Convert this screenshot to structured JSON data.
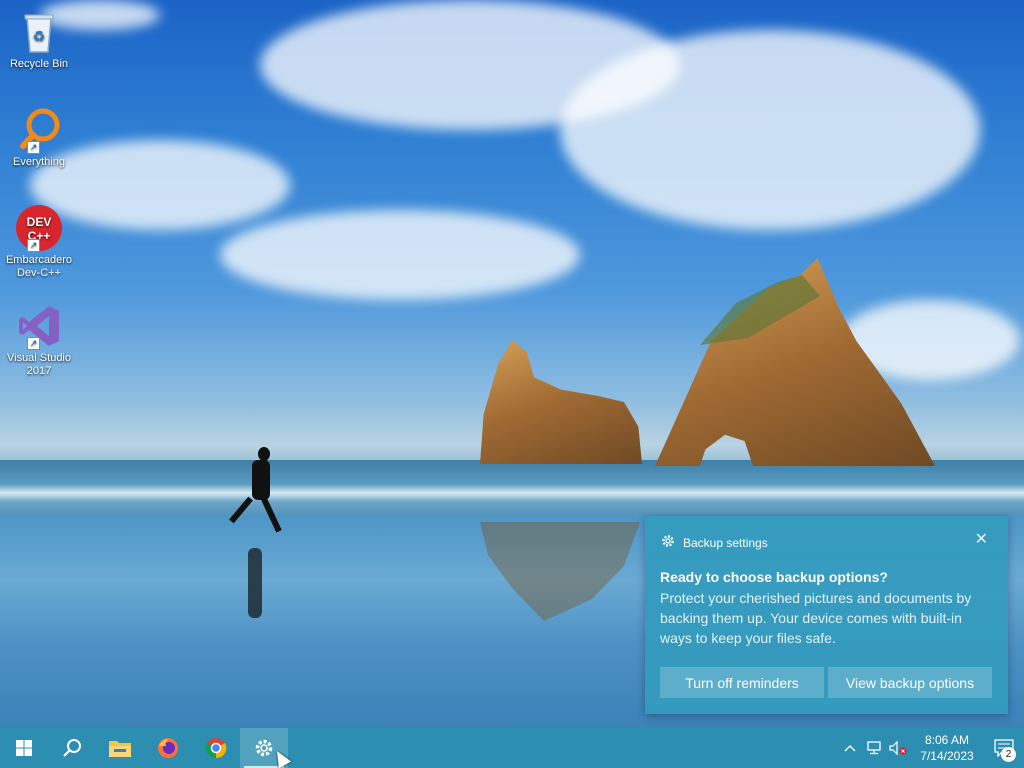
{
  "desktop_icons": [
    {
      "label": "Recycle Bin",
      "icon": "recycle-bin-icon"
    },
    {
      "label": "Everything",
      "icon": "everything-search-icon"
    },
    {
      "label": "Embarcadero Dev-C++",
      "icon": "devcpp-icon",
      "badge": "DEV C++"
    },
    {
      "label": "Visual Studio 2017",
      "icon": "visual-studio-icon"
    }
  ],
  "toast": {
    "app_name": "Backup settings",
    "title": "Ready to choose backup options?",
    "body": "Protect your cherished pictures and documents by backing them up. Your device comes with built-in ways to keep your files safe.",
    "button_off": "Turn off reminders",
    "button_view": "View backup options",
    "close_glyph": "✕"
  },
  "taskbar": {
    "clock_time": "8:06 AM",
    "clock_date": "7/14/2023",
    "notification_count": "2"
  },
  "colors": {
    "taskbar": "#2c8eb0",
    "toast": "#339bbe"
  }
}
